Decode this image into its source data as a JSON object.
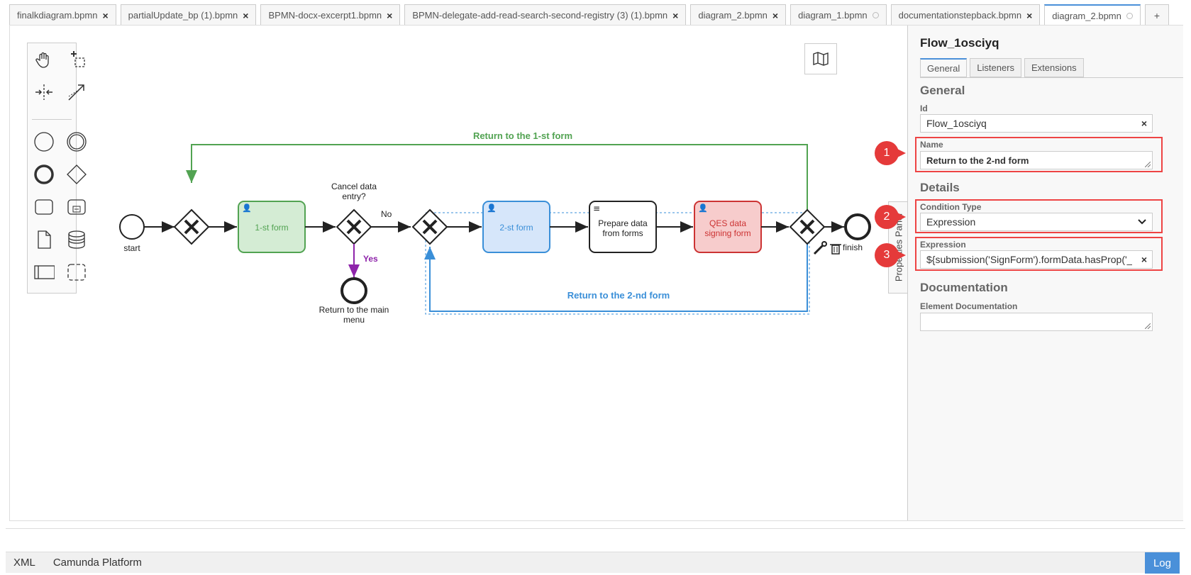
{
  "tabs": [
    {
      "label": "finalkdiagram.bpmn",
      "mark": "close"
    },
    {
      "label": "partialUpdate_bp (1).bpmn",
      "mark": "close"
    },
    {
      "label": "BPMN-docx-excerpt1.bpmn",
      "mark": "close"
    },
    {
      "label": "BPMN-delegate-add-read-search-second-registry (3) (1).bpmn",
      "mark": "close"
    },
    {
      "label": "diagram_2.bpmn",
      "mark": "close"
    },
    {
      "label": "diagram_1.bpmn",
      "mark": "dot"
    },
    {
      "label": "documentationstepback.bpmn",
      "mark": "close"
    },
    {
      "label": "diagram_2.bpmn",
      "mark": "dot",
      "active": true
    }
  ],
  "add_tab_label": "+",
  "diagram": {
    "flow_top_label": "Return to the 1-st form",
    "flow_bottom_label": "Return to the 2-nd form",
    "start_label": "start",
    "finish_label": "finish",
    "task_1": "1-st form",
    "task_2": "2-st form",
    "task_3_line1": "Prepare data",
    "task_3_line2": "from forms",
    "task_4_line1": "QES data",
    "task_4_line2": "signing form",
    "gateway_cancel_line1": "Cancel data",
    "gateway_cancel_line2": "entry?",
    "no_label": "No",
    "yes_label": "Yes",
    "end_main_line1": "Return to the main",
    "end_main_line2": "menu"
  },
  "colors": {
    "green": "#52a352",
    "blue": "#3a8fd8",
    "red": "#cc3333",
    "purple": "#8e24aa",
    "accent": "#4a90d9"
  },
  "properties": {
    "panel_toggle_label": "Properties Panel",
    "title": "Flow_1osciyq",
    "tabs": [
      "General",
      "Listeners",
      "Extensions"
    ],
    "general_heading": "General",
    "id_label": "Id",
    "id_value": "Flow_1osciyq",
    "name_label": "Name",
    "name_value": "Return to the 2-nd form",
    "details_heading": "Details",
    "condition_type_label": "Condition Type",
    "condition_type_value": "Expression",
    "expression_label": "Expression",
    "expression_value": "${submission('SignForm').formData.hasProp('_",
    "documentation_heading": "Documentation",
    "element_documentation_label": "Element Documentation",
    "element_documentation_value": ""
  },
  "badges": [
    "1",
    "2",
    "3"
  ],
  "status": {
    "xml": "XML",
    "platform": "Camunda Platform",
    "log": "Log"
  }
}
